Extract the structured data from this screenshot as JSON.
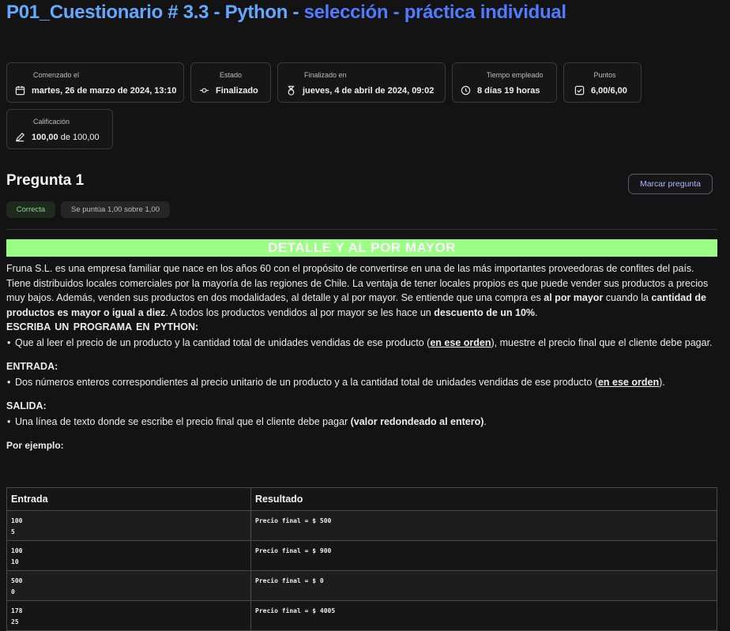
{
  "page": {
    "title_part1": "P01_Cuestionario # 3.3 - Python - ",
    "title_part2": "selección - práctica individual"
  },
  "summary": {
    "started": {
      "label": "Comenzado el",
      "value": "martes, 26 de marzo de 2024, 13:10",
      "icon": "calendar-icon"
    },
    "state": {
      "label": "Estado",
      "value": "Finalizado",
      "icon": "status-icon"
    },
    "finished": {
      "label": "Finalizado en",
      "value": "jueves, 4 de abril de 2024, 09:02",
      "icon": "stopwatch-icon"
    },
    "time": {
      "label": "Tiempo empleado",
      "value": "8 días 19 horas",
      "icon": "clock-icon"
    },
    "points": {
      "label": "Puntos",
      "value": "6,00/6,00",
      "icon": "checkbox-icon"
    },
    "grade": {
      "label": "Calificación",
      "value_bold": "100,00",
      "value_rest": " de 100,00",
      "icon": "pencil-icon"
    }
  },
  "question": {
    "title": "Pregunta 1",
    "flag_label": "Marcar pregunta",
    "status": "Correcta",
    "score": "Se puntúa 1,00 sobre 1,00"
  },
  "problem": {
    "banner": "DETALLE Y AL POR MAYOR",
    "intro_1": "Fruna S.L. es una empresa familiar que nace en los años 60 con el propósito de convertirse en una de las más importantes proveedoras de confites del país. Tiene distribuidos locales comerciales por la mayoría de las regiones de Chile. La ventaja de tener locales propios es que puede vender sus productos a precios muy bajos. Además, venden sus productos en dos modalidades, al detalle y al por mayor. Se entiende que una compra es ",
    "intro_b1": "al por mayor",
    "intro_2": " cuando la ",
    "intro_b2": "cantidad de productos es mayor o igual a diez",
    "intro_3": ". A todos los productos vendidos al por mayor se les hace un ",
    "intro_b3": "descuento de un 10%",
    "intro_4": ".",
    "heading_program": "ESCRIBA UN PROGRAMA EN PYTHON:",
    "program_1": "Que al leer el precio de un producto y la cantidad total de unidades vendidas de ese producto (",
    "program_u": "en ese orden",
    "program_2": "), muestre el precio final que el cliente debe pagar.",
    "heading_input": "ENTRADA:",
    "input_1": "Dos números enteros correspondientes al precio unitario de un producto y a la cantidad total de unidades vendidas de ese producto (",
    "input_u": "en ese orden",
    "input_2": ").",
    "heading_output": "SALIDA:",
    "output_1": "Una línea de texto donde se escribe el precio final que el cliente debe pagar ",
    "output_b": "(valor redondeado al entero)",
    "output_2": ".",
    "example_heading": "Por ejemplo:"
  },
  "examples": {
    "headers": [
      "Entrada",
      "Resultado"
    ],
    "rows": [
      {
        "input": "100\n5",
        "output": "Precio final = $ 500"
      },
      {
        "input": "100\n10",
        "output": "Precio final = $ 900"
      },
      {
        "input": "500\n0",
        "output": "Precio final = $ 0"
      },
      {
        "input": "178\n25",
        "output": "Precio final = $ 4005"
      }
    ]
  },
  "colors": {
    "title_blue_light": "#62a8ff",
    "title_blue": "#4e7bff",
    "banner_green": "#9bff85",
    "correct_green": "#8ed18a"
  }
}
